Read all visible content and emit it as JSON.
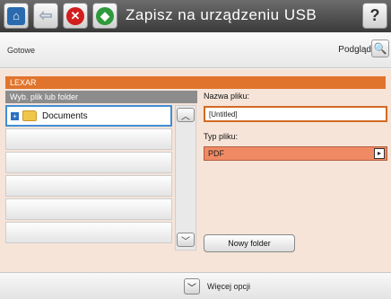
{
  "header": {
    "title": "Zapisz na urządzeniu USB",
    "icons": [
      "home-icon",
      "back-icon",
      "stop-icon",
      "start-icon",
      "help-icon"
    ]
  },
  "status": {
    "text": "Gotowe",
    "preview_label": "Podgląd"
  },
  "device": {
    "name": "LEXAR",
    "column_header": "Wyb. plik lub folder",
    "items": [
      {
        "label": "Documents",
        "selected": true
      }
    ]
  },
  "form": {
    "filename_label": "Nazwa pliku:",
    "filename_value": "[Untitled]",
    "filetype_label": "Typ pliku:",
    "filetype_value": "PDF",
    "new_folder_label": "Nowy folder"
  },
  "footer": {
    "more_options_label": "Więcej opcji"
  },
  "colors": {
    "accent_orange": "#e0742c",
    "panel_bg": "#f6e4d9",
    "filetype_bg": "#f08a65",
    "selection_blue": "#3f8ed6"
  }
}
